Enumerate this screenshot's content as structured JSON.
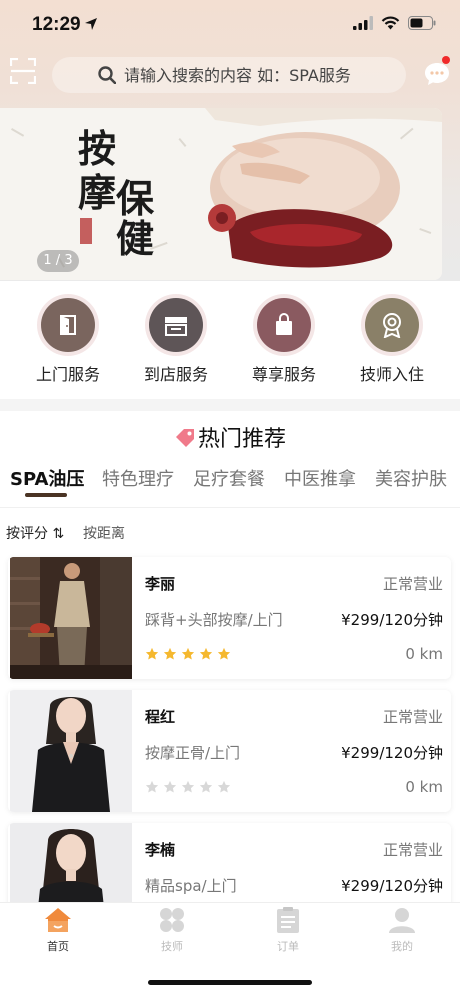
{
  "status_bar": {
    "time": "12:29"
  },
  "search": {
    "placeholder": "请输入搜索的内容 如：SPA服务"
  },
  "banner": {
    "title_chars": [
      "按",
      "摩",
      "保",
      "健"
    ],
    "counter": "1 / 3"
  },
  "categories": [
    {
      "label": "上门服务",
      "icon": "door-icon",
      "color": "#7a655e"
    },
    {
      "label": "到店服务",
      "icon": "store-icon",
      "color": "#5e5557"
    },
    {
      "label": "尊享服务",
      "icon": "bag-icon",
      "color": "#8a5a60"
    },
    {
      "label": "技师入住",
      "icon": "badge-icon",
      "color": "#8a8068"
    }
  ],
  "hot": {
    "title": "热门推荐",
    "tabs": [
      "SPA油压",
      "特色理疗",
      "足疗套餐",
      "中医推拿",
      "美容护肤"
    ],
    "active_tab": 0,
    "sort": {
      "by_rating": "按评分 ⇅",
      "by_distance": "按距离"
    }
  },
  "therapists": [
    {
      "name": "李丽",
      "status": "正常营业",
      "service": "踩背+头部按摩/上门",
      "price": "¥299/120分钟",
      "rating": 5,
      "distance": "0 km"
    },
    {
      "name": "程红",
      "status": "正常营业",
      "service": "按摩正骨/上门",
      "price": "¥299/120分钟",
      "rating": 0,
      "distance": "0 km"
    },
    {
      "name": "李楠",
      "status": "正常营业",
      "service": "精品spa/上门",
      "price": "¥299/120分钟",
      "rating": 0,
      "distance": "0 km"
    }
  ],
  "tabbar": {
    "items": [
      {
        "label": "首页",
        "icon": "home-icon",
        "active": true
      },
      {
        "label": "技师",
        "icon": "grid-icon",
        "active": false
      },
      {
        "label": "订单",
        "icon": "clipboard-icon",
        "active": false
      },
      {
        "label": "我的",
        "icon": "person-icon",
        "active": false
      }
    ]
  },
  "colors": {
    "accent_orange": "#f08a3c",
    "star_gold": "#f5b82e",
    "star_gray": "#d8d8d8",
    "tab_underline": "#4a3324"
  }
}
